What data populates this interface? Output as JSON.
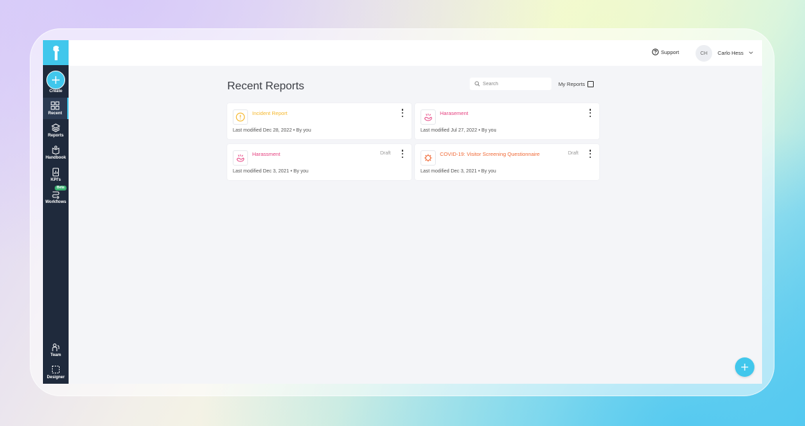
{
  "app": {
    "brand_color": "#41c7ec",
    "sidebar_color": "#1f2a3c"
  },
  "sidebar": {
    "create_label": "Create",
    "items": [
      {
        "label": "Recent",
        "icon": "grid-icon",
        "active": true
      },
      {
        "label": "Reports",
        "icon": "layers-icon",
        "active": false
      },
      {
        "label": "Handbook",
        "icon": "handbook-icon",
        "active": false
      },
      {
        "label": "KPI's",
        "icon": "kpi-icon",
        "active": false
      },
      {
        "label": "Workflows",
        "icon": "workflow-icon",
        "active": false,
        "badge": "Beta"
      }
    ],
    "bottom_items": [
      {
        "label": "Team",
        "icon": "team-icon"
      },
      {
        "label": "Designer",
        "icon": "designer-icon"
      }
    ]
  },
  "topbar": {
    "support_label": "Support",
    "user_initials": "CH",
    "user_name": "Carlo Hess"
  },
  "main": {
    "title": "Recent Reports",
    "search_placeholder": "Search",
    "my_reports_label": "My Reports",
    "my_reports_checked": false,
    "cards": [
      {
        "title": "Incident Report",
        "meta": "Last modified Dec 28, 2022 • By you",
        "status": "",
        "color": "#f5b82e",
        "icon": "warning-icon"
      },
      {
        "title": "Harasement",
        "meta": "Last modified Jul 27, 2022 • By you",
        "status": "",
        "color": "#e5407f",
        "icon": "harassment-icon"
      },
      {
        "title": "Harassment",
        "meta": "Last modified Dec 3, 2021 • By you",
        "status": "Draft",
        "color": "#e5407f",
        "icon": "harassment-icon"
      },
      {
        "title": "COVID-19: Visitor Screening Questionnaire",
        "meta": "Last modified Dec 3, 2021 • By you",
        "status": "Draft",
        "color": "#f06a37",
        "icon": "virus-icon"
      }
    ]
  }
}
